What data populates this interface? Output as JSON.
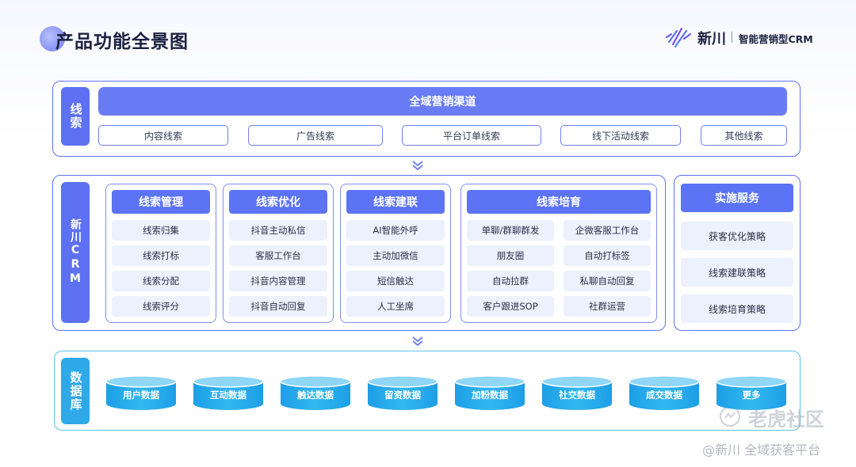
{
  "header": {
    "title": "产品功能全景图",
    "brand_name": "新川",
    "brand_tag": "智能营销型CRM"
  },
  "clue": {
    "label": "线索",
    "banner": "全域营销渠道",
    "channels": [
      "内容线索",
      "广告线索",
      "平台订单线索",
      "线下活动线索",
      "其他线索"
    ]
  },
  "crm": {
    "label": "新川CRM",
    "groups": [
      {
        "title": "线索管理",
        "items": [
          "线索归集",
          "线索打标",
          "线索分配",
          "线索评分"
        ]
      },
      {
        "title": "线索优化",
        "items": [
          "抖音主动私信",
          "客服工作台",
          "抖音内容管理",
          "抖音自动回复"
        ]
      },
      {
        "title": "线索建联",
        "items": [
          "AI智能外呼",
          "主动加微信",
          "短信触达",
          "人工坐席"
        ]
      },
      {
        "title": "线索培育",
        "items": [
          "单聊/群聊群发",
          "企微客服工作台",
          "朋友圈",
          "自动打标签",
          "自动拉群",
          "私聊自动回复",
          "客户跟进SOP",
          "社群运营"
        ]
      }
    ],
    "service": {
      "title": "实施服务",
      "items": [
        "获客优化策略",
        "线索建联策略",
        "线索培育策略"
      ]
    }
  },
  "database": {
    "label": "数据库",
    "items": [
      "用户数据",
      "互动数据",
      "触达数据",
      "留资数据",
      "加粉数据",
      "社交数据",
      "成交数据",
      "更多"
    ]
  },
  "watermark": {
    "site": "老虎社区",
    "credit": "@新川 全域获客平台"
  },
  "colors": {
    "primary": "#5d71f2",
    "accent": "#2fa9e8",
    "item_bg": "#edf1fd"
  }
}
